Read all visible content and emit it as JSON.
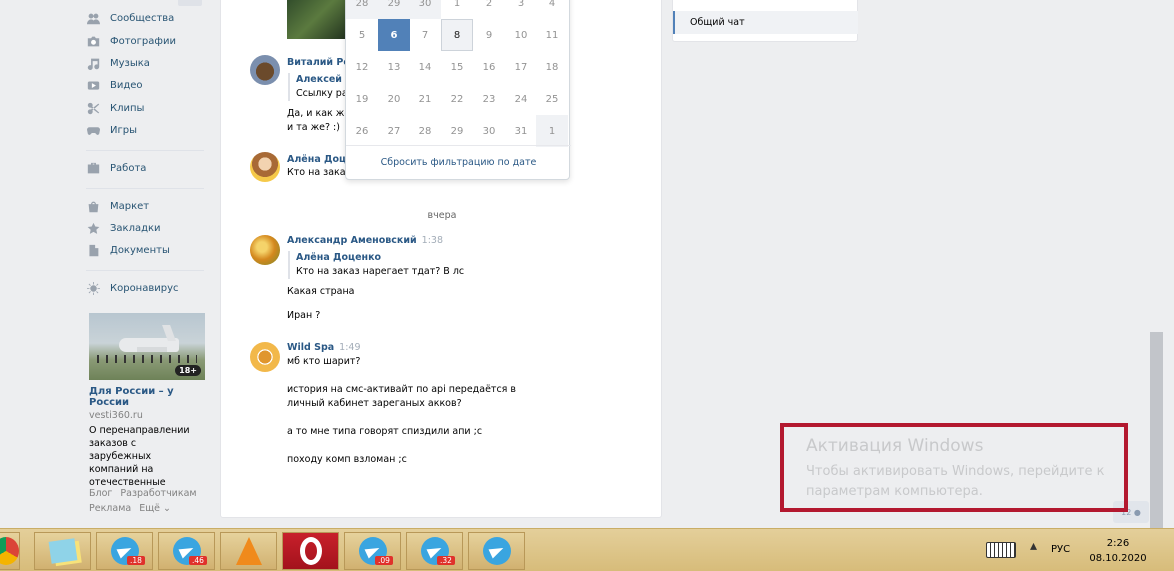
{
  "sidebar": {
    "items": [
      {
        "label": "Сообщества",
        "icon": "groups-icon"
      },
      {
        "label": "Фотографии",
        "icon": "camera-icon"
      },
      {
        "label": "Музыка",
        "icon": "music-note-icon"
      },
      {
        "label": "Видео",
        "icon": "video-icon"
      },
      {
        "label": "Клипы",
        "icon": "clips-icon"
      },
      {
        "label": "Игры",
        "icon": "gamepad-icon"
      },
      {
        "label": "Работа",
        "icon": "briefcase-icon"
      },
      {
        "label": "Маркет",
        "icon": "shopping-bag-icon"
      },
      {
        "label": "Закладки",
        "icon": "star-icon"
      },
      {
        "label": "Документы",
        "icon": "document-icon"
      },
      {
        "label": "Коронавирус",
        "icon": "virus-icon"
      }
    ],
    "ad": {
      "title": "Для России – у России",
      "domain": "vesti360.ru",
      "text": "О перенаправлении заказов с зарубежных компаний на отечественные",
      "age": "18+"
    },
    "footer": {
      "blog": "Блог",
      "dev": "Разработчикам",
      "ads": "Реклама",
      "more": "Ещё ⌄"
    }
  },
  "calendar": {
    "rows": [
      [
        "28",
        "29",
        "30",
        "1",
        "2",
        "3",
        "4"
      ],
      [
        "5",
        "6",
        "7",
        "8",
        "9",
        "10",
        "11"
      ],
      [
        "12",
        "13",
        "14",
        "15",
        "16",
        "17",
        "18"
      ],
      [
        "19",
        "20",
        "21",
        "22",
        "23",
        "24",
        "25"
      ],
      [
        "26",
        "27",
        "28",
        "29",
        "30",
        "31",
        "1"
      ]
    ],
    "selected": "6",
    "today": "8",
    "reset_label": "Сбросить фильтрацию по дате"
  },
  "chat": {
    "date_separator": "вчера",
    "messages": [
      {
        "author": "Виталий Ром",
        "time": "",
        "quote_author": "Алексей Зо",
        "quote_text": "Ссылку ра",
        "lines": [
          "Да, и как же",
          "и та же? :)"
        ]
      },
      {
        "author": "Алёна Доцен",
        "time": "",
        "lines": [
          "Кто на заказ"
        ]
      },
      {
        "author": "Александр Аменовский",
        "time": "1:38",
        "quote_author": "Алёна Доценко",
        "quote_text": "Кто на заказ нарегает тдат? В лс",
        "lines": [
          "Какая страна",
          "Иран ?"
        ]
      },
      {
        "author": "Wild Spa",
        "time": "1:49",
        "lines": [
          "мб кто шарит?",
          "история на смс-активайт по api передаётся в",
          "личный кабинет зареганых акков?",
          "а то мне типа говорят спиздили апи ;с",
          "походу комп взломан ;с"
        ]
      }
    ]
  },
  "right_panel": {
    "item": "Общий чат"
  },
  "online_count": "12",
  "watermark": {
    "title": "Активация Windows",
    "text": "Чтобы активировать Windows, перейдите к параметрам компьютера."
  },
  "taskbar": {
    "badges": [
      ".18",
      ".46",
      ".09",
      ".32"
    ],
    "lang": "РУС",
    "time": "2:26",
    "date": "08.10.2020"
  }
}
